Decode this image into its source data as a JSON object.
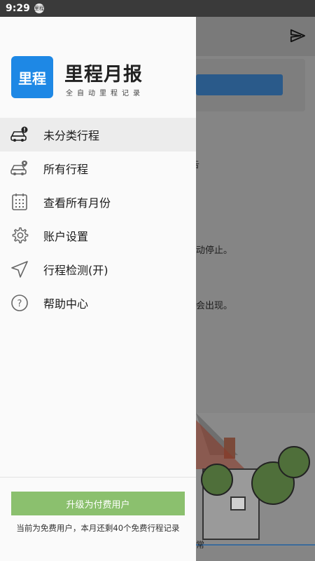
{
  "status_bar": {
    "time": "9:29",
    "notification_badge": "里程"
  },
  "background_app": {
    "text_fragments": [
      "告",
      "动停止。",
      "会出现。",
      "常"
    ]
  },
  "drawer": {
    "logo_text": "里程",
    "app_name": "里程月报",
    "app_subtitle": "全自动里程记录",
    "menu": [
      {
        "label": "未分类行程",
        "icon": "car-alert-icon",
        "active": true
      },
      {
        "label": "所有行程",
        "icon": "car-location-icon",
        "active": false
      },
      {
        "label": "查看所有月份",
        "icon": "calendar-icon",
        "active": false
      },
      {
        "label": "账户设置",
        "icon": "gear-icon",
        "active": false
      },
      {
        "label": "行程检测(开)",
        "icon": "navigation-icon",
        "active": false
      },
      {
        "label": "帮助中心",
        "icon": "help-icon",
        "active": false
      }
    ],
    "upgrade_button": "升级为付费用户",
    "footer_note": "当前为免费用户，本月还剩40个免费行程记录"
  },
  "colors": {
    "accent_green": "#8bc06e",
    "logo_blue": "#1e88e5",
    "active_item_bg": "#ececec"
  }
}
